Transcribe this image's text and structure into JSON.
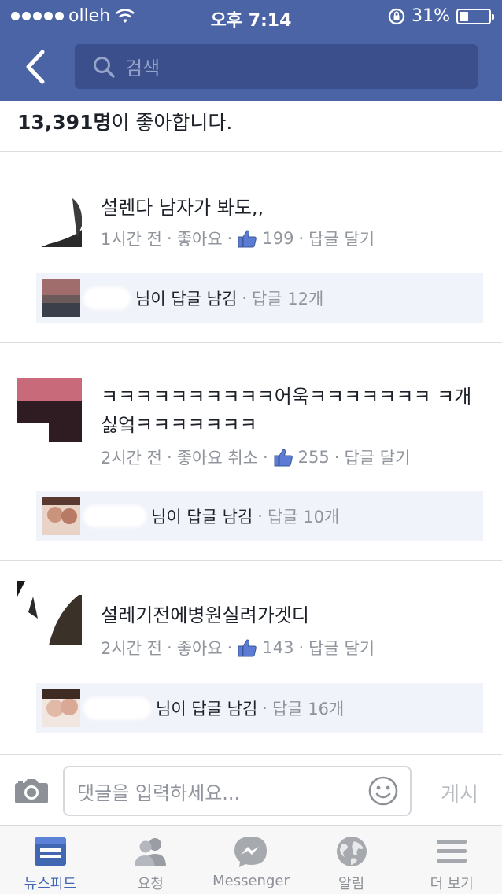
{
  "status_bar": {
    "carrier": "olleh",
    "time": "오후 7:14",
    "battery": "31%",
    "battery_level": 0.31
  },
  "header": {
    "search_placeholder": "검색"
  },
  "likes_summary": {
    "count": "13,391명",
    "suffix": "이 좋아합니다."
  },
  "comments": [
    {
      "name": "",
      "text": "설렌다 남자가 봐도,,",
      "time": "1시간 전",
      "like_label": "좋아요",
      "like_count": "199",
      "reply_label": "답글 달기",
      "reply_summary": "님이 답글 남김",
      "reply_count": "답글 12개"
    },
    {
      "name": "",
      "text": "ㅋㅋㅋㅋㅋㅋㅋㅋㅋㅋ어욱ㅋㅋㅋㅋㅋㅋㅋ ㅋ개싫엌ㅋㅋㅋㅋㅋㅋㅋ",
      "time": "2시간 전",
      "like_label": "좋아요 취소",
      "like_count": "255",
      "reply_label": "답글 달기",
      "reply_summary": "님이 답글 남김",
      "reply_count": "답글 10개"
    },
    {
      "name": "",
      "text": "설레기전에병원실려가겟디",
      "time": "2시간 전",
      "like_label": "좋아요",
      "like_count": "143",
      "reply_label": "답글 달기",
      "reply_summary": "님이 답글 남김",
      "reply_count": "답글 16개"
    }
  ],
  "comment_input": {
    "placeholder": "댓글을 입력하세요...",
    "post_label": "게시"
  },
  "tabbar": {
    "items": [
      {
        "label": "뉴스피드",
        "icon": "news-feed-icon",
        "active": true
      },
      {
        "label": "요청",
        "icon": "friend-requests-icon",
        "active": false
      },
      {
        "label": "Messenger",
        "icon": "messenger-icon",
        "active": false
      },
      {
        "label": "알림",
        "icon": "notifications-globe-icon",
        "active": false
      },
      {
        "label": "더 보기",
        "icon": "more-menu-icon",
        "active": false
      }
    ]
  },
  "colors": {
    "header_bg": "#4b64a5",
    "search_bg": "#3a4f8b",
    "accent": "#4267b2",
    "meta_text": "#90949c",
    "reply_bg": "#f1f3fa"
  }
}
